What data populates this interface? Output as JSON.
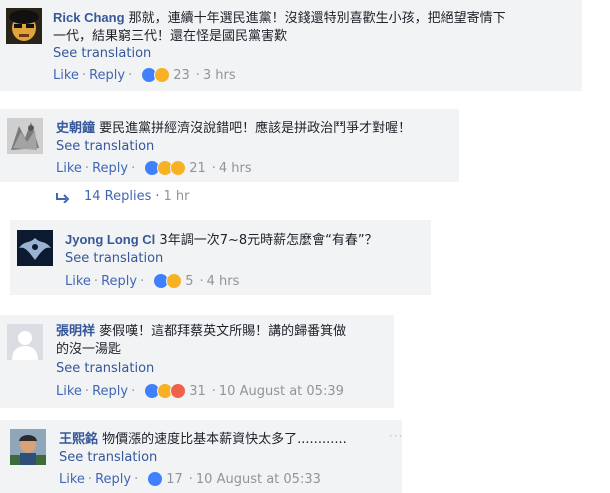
{
  "comments": [
    {
      "author": "Rick Chang",
      "text_line1": "那就，連續十年選民進黨！沒錢還特別喜歡生小孩，把絕望寄情下",
      "text_line2": "一代，結果窮三代！還在怪是國民黨害歎",
      "see_translation": "See translation",
      "like": "Like",
      "reply": "Reply",
      "reaction_icons": [
        "like-reaction-icon",
        "haha-reaction-icon"
      ],
      "reaction_count": "23",
      "time": "3 hrs"
    },
    {
      "author": "史朝鐘",
      "text_line1": "要民進黨拼經濟沒說錯吧！應該是拼政治鬥爭才對喔！",
      "see_translation": "See translation",
      "like": "Like",
      "reply": "Reply",
      "reaction_icons": [
        "like-reaction-icon",
        "haha-reaction-icon",
        "wow-reaction-icon"
      ],
      "reaction_count": "21",
      "time": "4 hrs",
      "replies_label": "14 Replies",
      "replies_time": "1 hr"
    },
    {
      "author": "Jyong Long Cl",
      "text_line1": "3年調一次7~8元時薪怎麼會“有春”？",
      "see_translation": "See translation",
      "like": "Like",
      "reply": "Reply",
      "reaction_icons": [
        "like-reaction-icon",
        "sad-reaction-icon"
      ],
      "reaction_count": "5",
      "time": "4 hrs"
    },
    {
      "author": "張明祥",
      "text_line1": "麥假嘆！這都拜蔡英文所賜！講的歸番箕做",
      "text_line2": "的沒一湯匙",
      "see_translation": "See translation",
      "like": "Like",
      "reply": "Reply",
      "reaction_icons": [
        "like-reaction-icon",
        "haha-reaction-icon",
        "angry-reaction-icon"
      ],
      "reaction_count": "31",
      "time": "10 August at 05:39"
    },
    {
      "author": "王熙銘",
      "text_line1": "物價漲的速度比基本薪資快太多了............",
      "see_translation": "See translation",
      "like": "Like",
      "reply": "Reply",
      "reaction_icons": [
        "like-reaction-icon"
      ],
      "reaction_count": "17",
      "time": "10 August at 05:33"
    }
  ],
  "colors": {
    "bubble_bg": "#f2f3f5",
    "name": "#365899",
    "link": "#4267b2",
    "meta": "#90949c",
    "like_blue": "#4080ff",
    "haha_yellow": "#f7b125",
    "angry_red": "#f0614a"
  }
}
